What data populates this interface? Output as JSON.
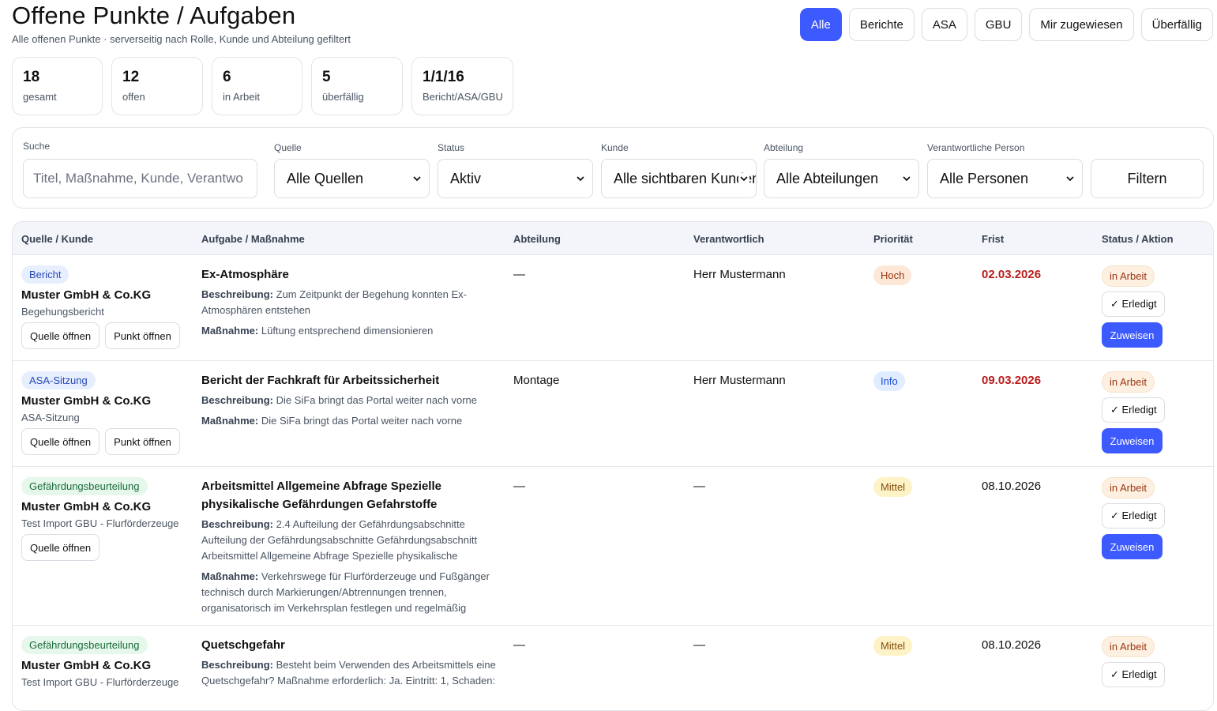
{
  "header": {
    "title": "Offene Punkte / Aufgaben",
    "subtitle": "Alle offenen Punkte · serverseitig nach Rolle, Kunde und Abteilung gefiltert"
  },
  "tabs": [
    {
      "label": "Alle",
      "active": true
    },
    {
      "label": "Berichte"
    },
    {
      "label": "ASA"
    },
    {
      "label": "GBU"
    },
    {
      "label": "Mir zugewiesen"
    },
    {
      "label": "Überfällig"
    }
  ],
  "stats": [
    {
      "value": "18",
      "label": "gesamt"
    },
    {
      "value": "12",
      "label": "offen"
    },
    {
      "value": "6",
      "label": "in Arbeit"
    },
    {
      "value": "5",
      "label": "überfällig"
    },
    {
      "value": "1/1/16",
      "label": "Bericht/ASA/GBU"
    }
  ],
  "filters": {
    "search_label": "Suche",
    "search_placeholder": "Titel, Maßnahme, Kunde, Verantwo",
    "source_label": "Quelle",
    "source_value": "Alle Quellen",
    "status_label": "Status",
    "status_value": "Aktiv",
    "customer_label": "Kunde",
    "customer_value": "Alle sichtbaren Kunden",
    "department_label": "Abteilung",
    "department_value": "Alle Abteilungen",
    "person_label": "Verantwortliche Person",
    "person_value": "Alle Personen",
    "filter_button": "Filtern"
  },
  "table": {
    "headers": [
      "Quelle / Kunde",
      "Aufgabe / Maßnahme",
      "Abteilung",
      "Verantwortlich",
      "Priorität",
      "Frist",
      "Status / Aktion"
    ],
    "rows": [
      {
        "source_badge": "Bericht",
        "customer": "Muster GmbH & Co.KG",
        "source_name": "Begehungsbericht",
        "btn_source": "Quelle öffnen",
        "btn_point": "Punkt öffnen",
        "title": "Ex-Atmosphäre",
        "desc_label": "Beschreibung:",
        "desc": "Zum Zeitpunkt der Begehung konnten Ex-Atmosphären entstehen",
        "measure_label": "Maßnahme:",
        "measure": "Lüftung entsprechend dimensionieren",
        "department": "—",
        "responsible": "Herr Mustermann",
        "priority": "Hoch",
        "deadline": "02.03.2026",
        "status": "in Arbeit",
        "done_label": "✓ Erledigt",
        "assign_label": "Zuweisen"
      },
      {
        "source_badge": "ASA-Sitzung",
        "customer": "Muster GmbH & Co.KG",
        "source_name": "ASA-Sitzung",
        "btn_source": "Quelle öffnen",
        "btn_point": "Punkt öffnen",
        "title": "Bericht der Fachkraft für Arbeitssicherheit",
        "desc_label": "Beschreibung:",
        "desc": "Die SiFa bringt das Portal weiter nach vorne",
        "measure_label": "Maßnahme:",
        "measure": "Die SiFa bringt das Portal weiter nach vorne",
        "department": "Montage",
        "responsible": "Herr Mustermann",
        "priority": "Info",
        "deadline": "09.03.2026",
        "status": "in Arbeit",
        "done_label": "✓ Erledigt",
        "assign_label": "Zuweisen"
      },
      {
        "source_badge": "Gefährdungsbeurteilung",
        "customer": "Muster GmbH & Co.KG",
        "source_name": "Test Import GBU - Flurförderzeuge",
        "btn_source": "Quelle öffnen",
        "title": "Arbeitsmittel Allgemeine Abfrage Spezielle physikalische Gefährdungen Gefahrstoffe",
        "desc_label": "Beschreibung:",
        "desc": "2.4 Aufteilung der Gefährdungsabschnitte Aufteilung der Gefährdungsabschnitte Gefährdungsabschnitt Arbeitsmittel Allgemeine Abfrage Spezielle physikalische",
        "measure_label": "Maßnahme:",
        "measure": "Verkehrswege für Flurförderzeuge und Fußgänger technisch durch Markierungen/Abtrennungen trennen, organisatorisch im Verkehrsplan festlegen und regelmäßig",
        "department": "—",
        "responsible": "—",
        "priority": "Mittel",
        "deadline": "08.10.2026",
        "status": "in Arbeit",
        "done_label": "✓ Erledigt",
        "assign_label": "Zuweisen"
      },
      {
        "source_badge": "Gefährdungsbeurteilung",
        "customer": "Muster GmbH & Co.KG",
        "source_name": "Test Import GBU - Flurförderzeuge",
        "title": "Quetschgefahr",
        "desc_label": "Beschreibung:",
        "desc": "Besteht beim Verwenden des Arbeitsmittels eine Quetschgefahr? Maßnahme erforderlich: Ja. Eintritt: 1, Schaden:",
        "department": "—",
        "responsible": "—",
        "priority": "Mittel",
        "deadline": "08.10.2026",
        "status": "in Arbeit",
        "done_label": "✓ Erledigt"
      }
    ]
  },
  "colors": {
    "accent": "#3d5afe",
    "overdue": "#b91c1c"
  }
}
